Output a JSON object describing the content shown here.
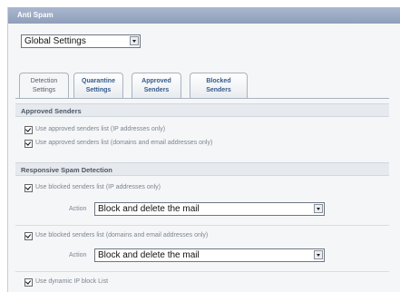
{
  "window": {
    "title": "Anti Spam"
  },
  "settings_select": {
    "value": "Global Settings"
  },
  "tabs": [
    {
      "label": "Detection Settings",
      "lines": [
        "Detection",
        "Settings"
      ],
      "active": true
    },
    {
      "label": "Quarantine Settings",
      "lines": [
        "Quarantine",
        "Settings"
      ],
      "active": false
    },
    {
      "label": "Approved Senders",
      "lines": [
        "Approved",
        "Senders"
      ],
      "active": false
    },
    {
      "label": "Blocked Senders",
      "lines": [
        "Blocked",
        "Senders"
      ],
      "active": false
    }
  ],
  "approved_section": {
    "title": "Approved Senders",
    "items": [
      {
        "label": "Use approved senders list (IP addresses only)",
        "checked": true
      },
      {
        "label": "Use approved senders list (domains and email addresses only)",
        "checked": true
      }
    ]
  },
  "responsive_section": {
    "title": "Responsive Spam Detection",
    "items": [
      {
        "label": "Use blocked senders list (IP addresses only)",
        "checked": true
      },
      {
        "label": "Use blocked senders list (domains and email addresses only)",
        "checked": true
      },
      {
        "label": "Use dynamic IP block List",
        "checked": true
      }
    ],
    "action_label": "Action",
    "actions": [
      {
        "value": "Block and delete the mail"
      },
      {
        "value": "Block and delete the mail"
      }
    ]
  },
  "colors": {
    "title_bar": "#9aaac3",
    "tab_text": "#345b8f",
    "section_bg": "#e6e9ed"
  }
}
